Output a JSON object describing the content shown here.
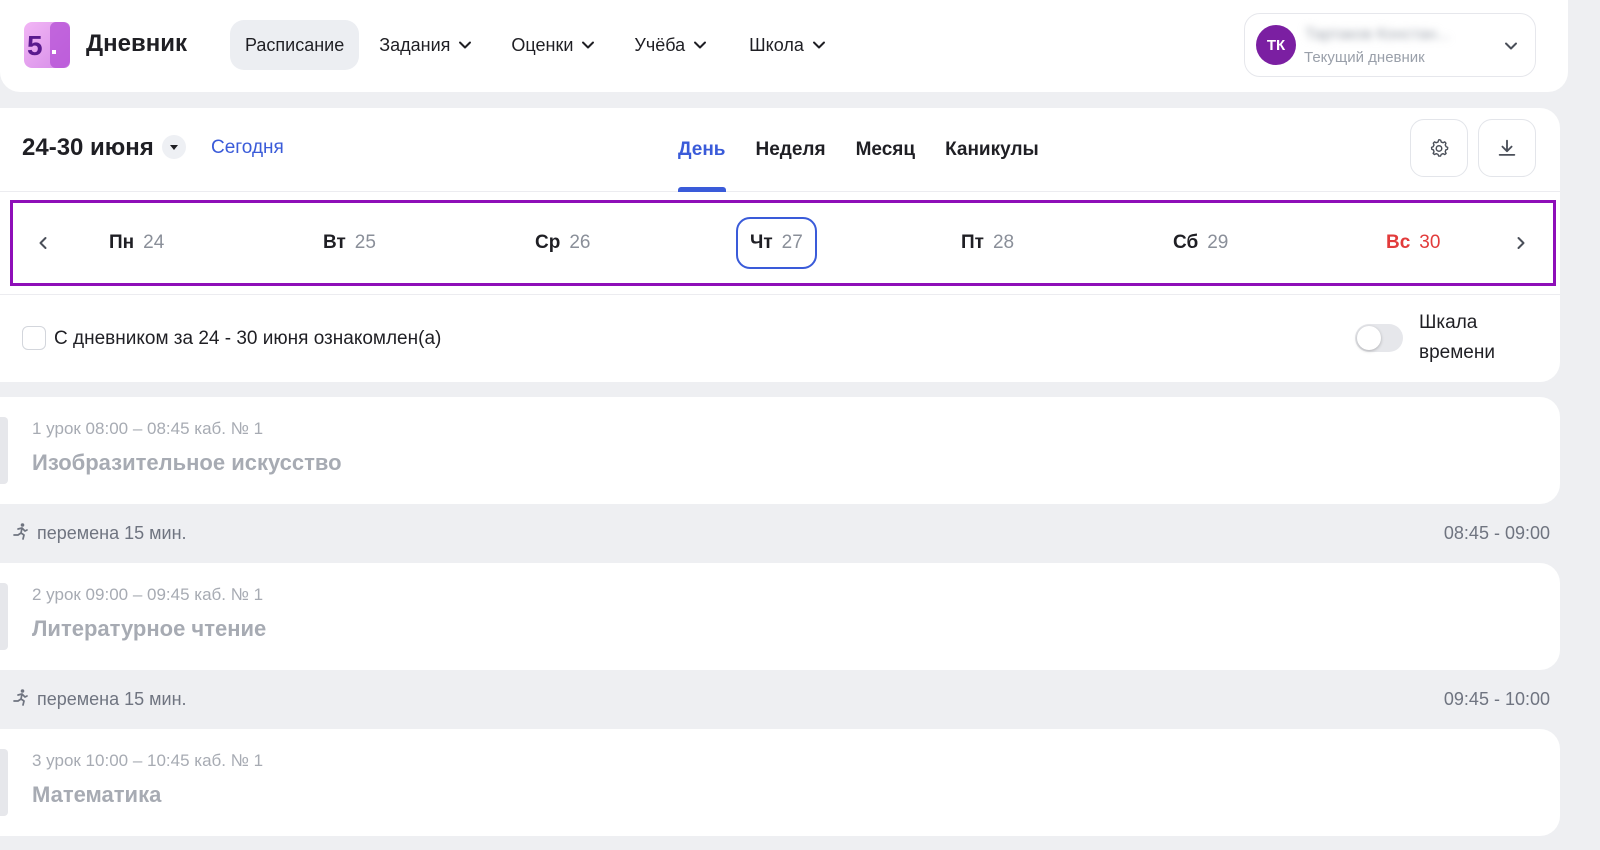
{
  "header": {
    "logo_text": "5",
    "brand": "Дневник",
    "nav": [
      {
        "label": "Расписание",
        "active": true,
        "dropdown": false
      },
      {
        "label": "Задания",
        "active": false,
        "dropdown": true
      },
      {
        "label": "Оценки",
        "active": false,
        "dropdown": true
      },
      {
        "label": "Учёба",
        "active": false,
        "dropdown": true
      },
      {
        "label": "Школа",
        "active": false,
        "dropdown": true
      }
    ],
    "user": {
      "initials": "ТК",
      "name": "Тартаков Констан...",
      "subtitle": "Текущий дневник"
    }
  },
  "schedule": {
    "period": "24-30 июня",
    "today_label": "Сегодня",
    "view_tabs": [
      "День",
      "Неделя",
      "Месяц",
      "Каникулы"
    ],
    "active_view": "День",
    "icons": {
      "settings": "gear-icon",
      "download": "download-icon"
    },
    "days": [
      {
        "name": "Пн",
        "num": "24"
      },
      {
        "name": "Вт",
        "num": "25"
      },
      {
        "name": "Ср",
        "num": "26"
      },
      {
        "name": "Чт",
        "num": "27"
      },
      {
        "name": "Пт",
        "num": "28"
      },
      {
        "name": "Сб",
        "num": "29"
      },
      {
        "name": "Вс",
        "num": "30"
      }
    ],
    "selected_day": "27",
    "ack_label": "С дневником за 24 - 30 июня ознакомлен(а)",
    "timeline_label": "Шкала времени",
    "timeline_on": false
  },
  "lessons": [
    {
      "meta": "1 урок 08:00 – 08:45 каб. № 1",
      "title": "Изобразительное искусство"
    },
    {
      "meta": "2 урок 09:00 – 09:45 каб. № 1",
      "title": "Литературное чтение"
    },
    {
      "meta": "3 урок 10:00 – 10:45 каб. № 1",
      "title": "Математика"
    }
  ],
  "breaks": [
    {
      "label": "перемена 15 мин.",
      "time": "08:45 - 09:00"
    },
    {
      "label": "перемена 15 мин.",
      "time": "09:45 - 10:00"
    }
  ],
  "colors": {
    "accent": "#3a5bd9",
    "highlight_border": "#8e0fb8",
    "avatar": "#7b1fa2",
    "weekend": "#e23b3b"
  }
}
